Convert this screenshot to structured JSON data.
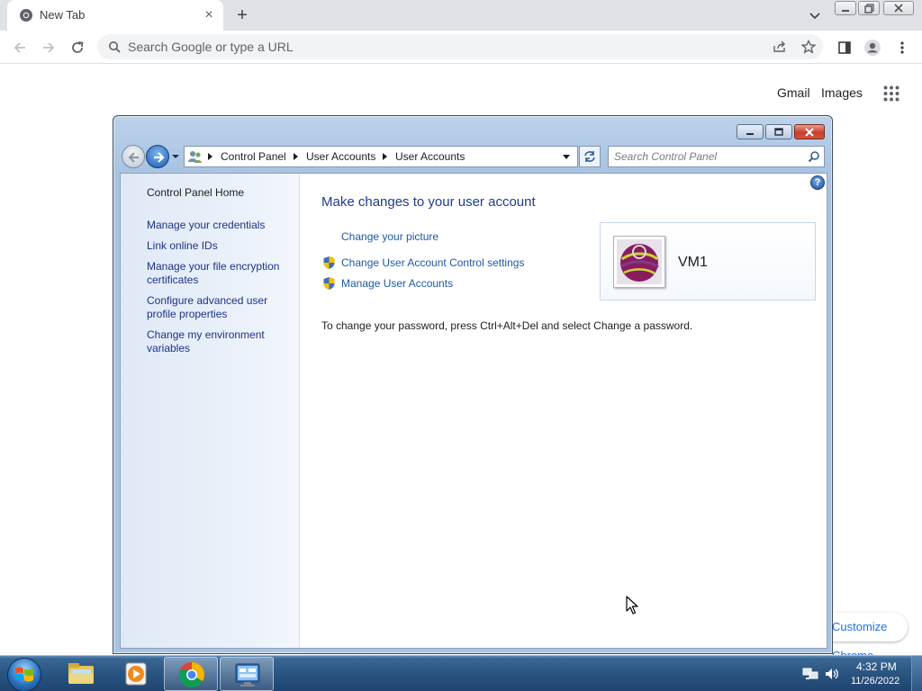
{
  "browser": {
    "tab_title": "New Tab",
    "omnibox_placeholder": "Search Google or type a URL",
    "ntp_gmail": "Gmail",
    "ntp_images": "Images",
    "customize_chrome": "Customize Chrome"
  },
  "explorer": {
    "breadcrumbs": [
      "Control Panel",
      "User Accounts",
      "User Accounts"
    ],
    "search_placeholder": "Search Control Panel",
    "sidebar": {
      "home": "Control Panel Home",
      "links": [
        "Manage your credentials",
        "Link online IDs",
        "Manage your file encryption certificates",
        "Configure advanced user profile properties",
        "Change my environment variables"
      ]
    },
    "main": {
      "title": "Make changes to your user account",
      "tasks": [
        "Change your picture",
        "Change User Account Control settings",
        "Manage User Accounts"
      ],
      "password_note": "To change your password, press Ctrl+Alt+Del and select Change a password.",
      "user_name": "VM1"
    }
  },
  "taskbar": {
    "time": "4:32 PM",
    "date": "11/26/2022",
    "pinned": [
      "windows-explorer-icon",
      "media-player-icon",
      "chrome-icon",
      "control-panel-icon"
    ]
  },
  "colors": {
    "link_blue": "#1c5aa3",
    "title_blue": "#1e3c87",
    "chrome_tabstrip": "#dee1e6"
  }
}
